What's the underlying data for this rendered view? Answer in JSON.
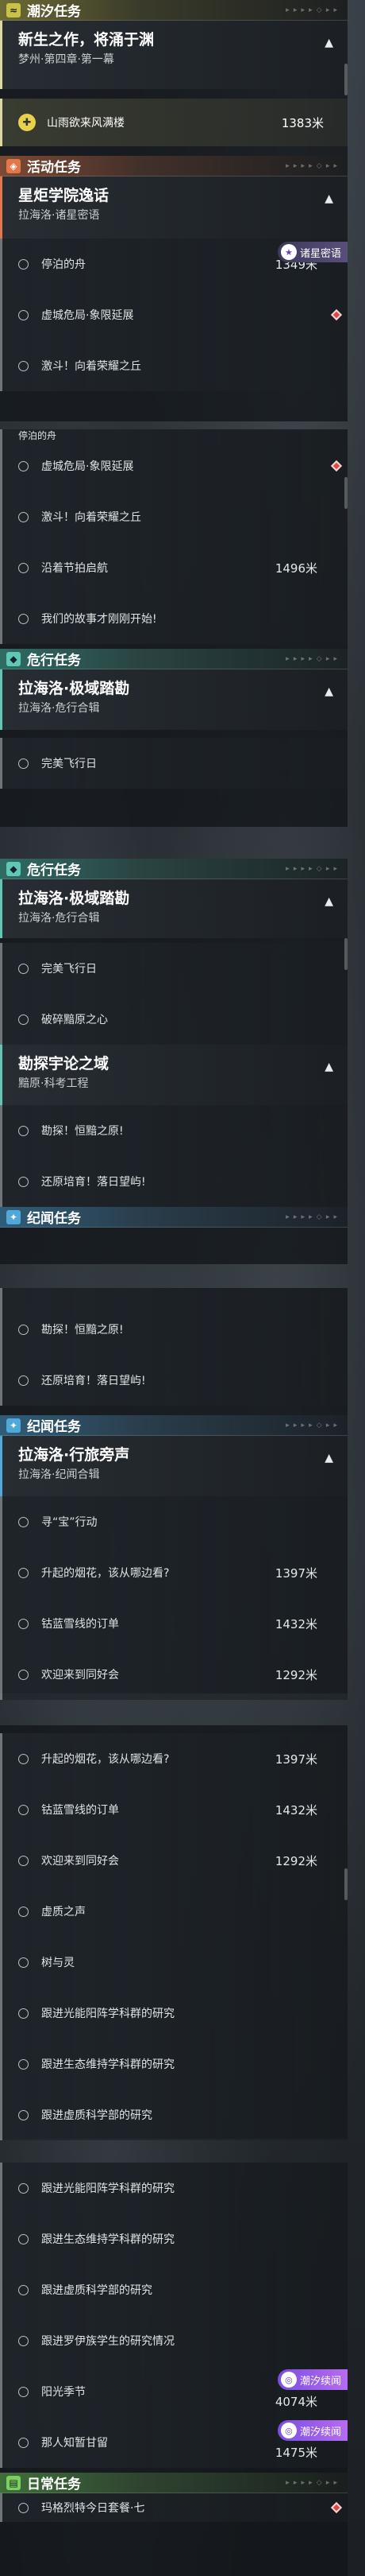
{
  "sections": {
    "tide": "潮汐任务",
    "event": "活动任务",
    "danger": "危行任务",
    "chronicle": "纪闻任务",
    "daily": "日常任务",
    "deco": "▸ ▸ ▸ ▸ ◇ ▸ ▸"
  },
  "tide_quest": {
    "title": "新生之作，将涌于渊",
    "sub": "梦州·第四章·第一幕",
    "active_step": "山雨欲来风满楼",
    "active_dist": "1383米"
  },
  "event_quest": {
    "title": "星炬学院逸话",
    "sub": "拉海洛·诸星密语",
    "badge": "诸星密语",
    "steps": [
      "停泊的舟",
      "虚城危局·象限延展",
      "激斗！向着荣耀之丘",
      "沿着节拍启航",
      "我们的故事才刚刚开始!"
    ],
    "dist_first": "1349米",
    "dist_fourth": "1496米"
  },
  "danger_quest": {
    "title": "拉海洛·极域踏勘",
    "sub": "拉海洛·危行合辑",
    "steps": [
      "完美飞行日",
      "破碎黯原之心"
    ]
  },
  "danger_quest2": {
    "title": "勘探宇论之域",
    "sub": "黯原·科考工程",
    "steps": [
      "勘探！恒黯之原!",
      "还原培育！落日望屿!"
    ]
  },
  "chron_quest": {
    "title": "拉海洛·行旅旁声",
    "sub": "拉海洛·纪闻合辑",
    "steps": [
      "寻“宝”行动",
      "升起的烟花，该从哪边看?",
      "钴蓝雪线的订单",
      "欢迎来到同好会",
      "虚质之声",
      "树与灵",
      "跟进光能阳阵学科群的研究",
      "跟进生态维持学科群的研究",
      "跟进虚质科学部的研究",
      "跟进罗伊族学生的研究情况"
    ],
    "dists": [
      "1397米",
      "1432米",
      "1292米"
    ]
  },
  "misc": {
    "row_a": "阳光季节",
    "row_a_dist": "4074米",
    "row_b": "那人知暂甘留",
    "row_b_dist": "1475米",
    "badge_tide": "潮汐续闻"
  },
  "daily_quest": {
    "step": "玛格烈特今日套餐·七"
  },
  "colors": {
    "tide": "#c8c247",
    "event": "#e0784a",
    "danger": "#5fc7b3",
    "chronicle": "#4fa8d8",
    "daily": "#7ccf5f",
    "badge_purple": "#9a5ce8"
  }
}
